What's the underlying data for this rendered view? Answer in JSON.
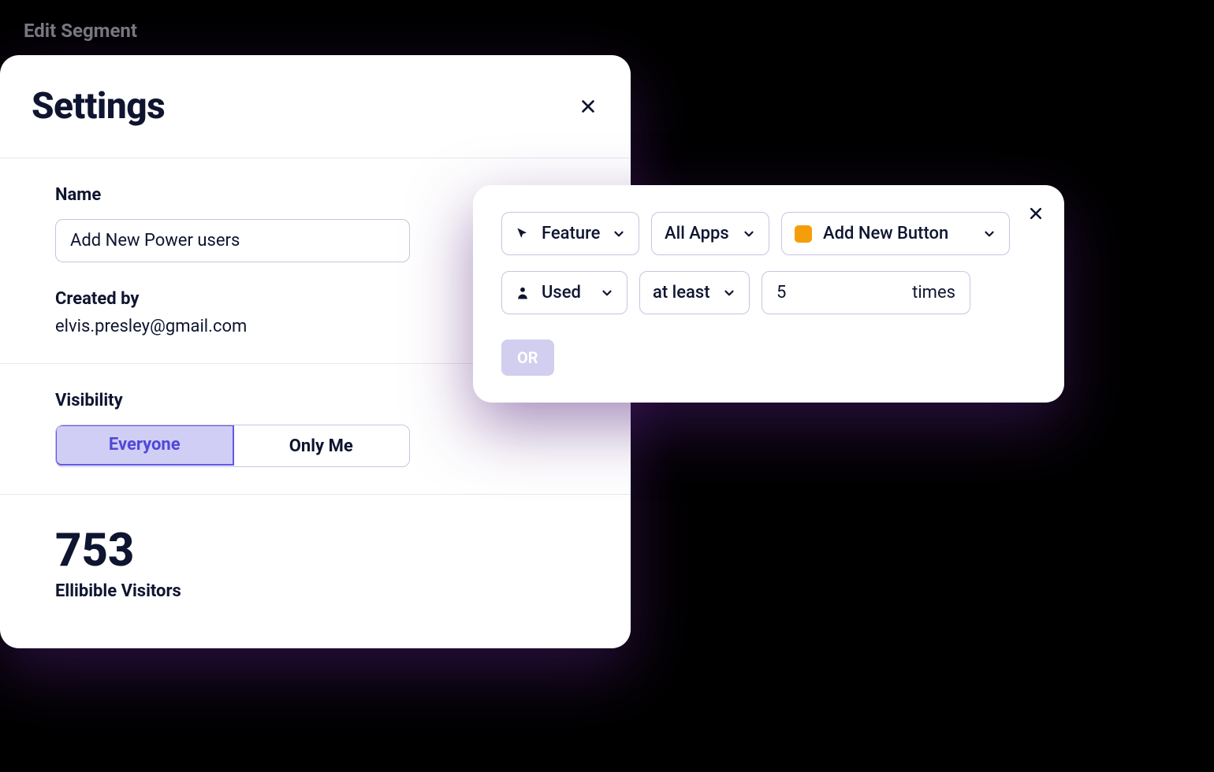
{
  "page_label": "Edit Segment",
  "settings": {
    "title": "Settings",
    "name_label": "Name",
    "name_value": "Add New Power users",
    "created_by_label": "Created by",
    "created_by_value": "elvis.presley@gmail.com",
    "visibility_label": "Visibility",
    "visibility_options": [
      "Everyone",
      "Only Me"
    ],
    "visibility_selected": "Everyone",
    "stat_number": "753",
    "stat_label": "Ellibible Visitors"
  },
  "condition": {
    "feature_label": "Feature",
    "apps_label": "All Apps",
    "button_label": "Add New Button",
    "button_color": "#f59e0b",
    "used_label": "Used",
    "comparator_label": "at least",
    "count_value": "5",
    "count_suffix": "times",
    "or_label": "OR"
  }
}
